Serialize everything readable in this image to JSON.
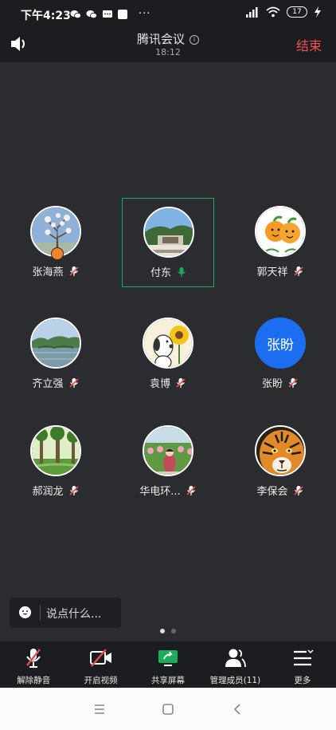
{
  "status_bar": {
    "time": "下午4:23",
    "dots": "···",
    "battery": "17"
  },
  "header": {
    "title": "腾讯会议",
    "info_icon": "i",
    "elapsed": "18:12",
    "end_label": "结束"
  },
  "participants": [
    {
      "name": "张海燕",
      "avatar": "plum-blossom-photo",
      "muted": true,
      "host": true
    },
    {
      "name": "付东",
      "avatar": "park-gate-photo",
      "muted": false,
      "speaking": true
    },
    {
      "name": "郭天祥",
      "avatar": "cartoon-oranges",
      "muted": true
    },
    {
      "name": "齐立强",
      "avatar": "lake-photo",
      "muted": true
    },
    {
      "name": "袁博",
      "avatar": "snoopy-sunflower",
      "muted": true
    },
    {
      "name": "张盼",
      "avatar_text": "张盼",
      "avatar_color": "#1c6ef0",
      "muted": true
    },
    {
      "name": "郝润龙",
      "avatar": "forest-photo",
      "muted": true
    },
    {
      "name": "华电环...",
      "avatar": "garden-person-photo",
      "muted": true
    },
    {
      "name": "李保会",
      "avatar": "tiger-photo",
      "muted": true
    }
  ],
  "chat": {
    "placeholder": "说点什么..."
  },
  "toolbar": [
    {
      "label": "解除静音",
      "icon": "mic-muted-icon"
    },
    {
      "label": "开启视频",
      "icon": "video-off-icon"
    },
    {
      "label": "共享屏幕",
      "icon": "share-screen-icon"
    },
    {
      "label": "管理成员(11)",
      "icon": "members-icon"
    },
    {
      "label": "更多",
      "icon": "more-menu-icon"
    }
  ],
  "colors": {
    "accent_green": "#1aad5b",
    "end_red": "#f25055",
    "muted_red": "#e84c4c",
    "background": "#2b2c2f"
  }
}
